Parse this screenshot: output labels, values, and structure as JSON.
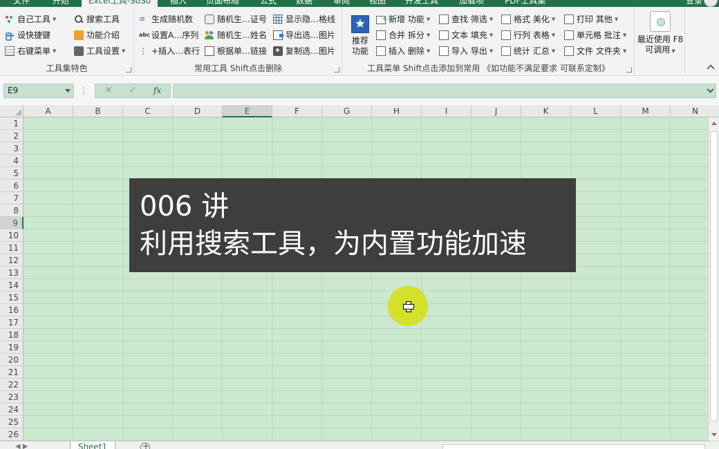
{
  "menu": {
    "file": "文件",
    "tabs": [
      "开始",
      "Excel工具-SoSo",
      "插入",
      "页面布局",
      "公式",
      "数据",
      "审阅",
      "视图",
      "开发工具",
      "加载项",
      "PDF工具集"
    ],
    "active_tab": "Excel工具-SoSo",
    "login": "登录"
  },
  "ribbon": {
    "group1": {
      "label": "工具集特色",
      "col1": [
        "自己工具",
        "设快捷键",
        "右键菜单"
      ],
      "col2": [
        "搜索工具",
        "功能介绍",
        "工具设置"
      ]
    },
    "group2": {
      "label": "常用工具 Shift点击删除",
      "col1": [
        "生成随机数",
        "设置A…序列",
        "+插入…表行"
      ],
      "col2": [
        "随机生…证号",
        "随机生…姓名",
        "根据单…链接"
      ],
      "col3": [
        "显示隐…格线",
        "导出选…图片",
        "复制选…图片"
      ]
    },
    "group3": {
      "label": "工具菜单 Shift点击添加到常用 《如功能不满足要求 可联系定制》",
      "big_button": "推荐功能",
      "col1": [
        "新增 功能",
        "合并 拆分",
        "插入 删除"
      ],
      "col2": [
        "查找 筛选",
        "文本 填充",
        "导入 导出"
      ],
      "col3": [
        "格式 美化",
        "行列 表格",
        "统计 汇总"
      ],
      "col4": [
        "打印 其他",
        "单元格 批注",
        "文件 文件夹"
      ]
    },
    "group4": {
      "recent_line1": "最近使用 F8",
      "recent_line2": "可调用"
    }
  },
  "formula_bar": {
    "name_box": "E9",
    "dots": "⋮",
    "cancel": "✕",
    "enter": "✓",
    "fx": "fx",
    "formula": ""
  },
  "grid": {
    "columns": [
      "A",
      "B",
      "C",
      "D",
      "E",
      "F",
      "G",
      "H",
      "I",
      "J",
      "K",
      "L",
      "M",
      "N"
    ],
    "rows": [
      "1",
      "2",
      "3",
      "4",
      "5",
      "6",
      "7",
      "8",
      "9",
      "10",
      "11",
      "12",
      "13",
      "14",
      "15",
      "16",
      "17",
      "18",
      "19",
      "20",
      "21",
      "22",
      "23",
      "24",
      "25",
      "26"
    ],
    "selected_column": "E",
    "selected_row": "9"
  },
  "caption": {
    "line1": "006 讲",
    "line2": "利用搜索工具，为内置功能加速"
  },
  "sheets": {
    "active": "Sheet1"
  }
}
